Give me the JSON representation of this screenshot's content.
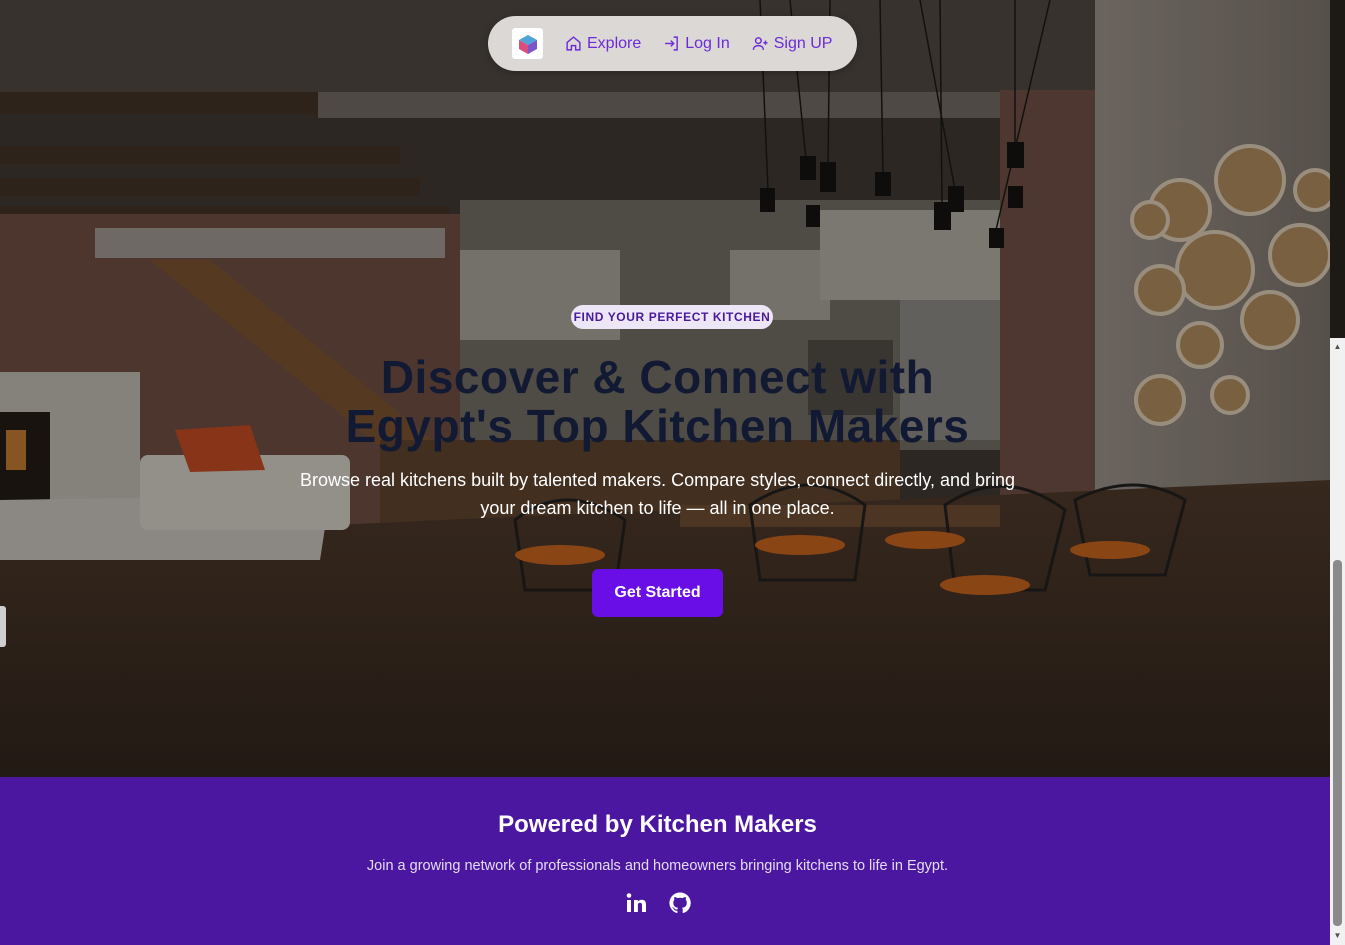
{
  "nav": {
    "logo_icon": "cube-logo-icon",
    "links": [
      {
        "label": "Explore",
        "icon": "home-icon"
      },
      {
        "label": "Log In",
        "icon": "login-icon"
      },
      {
        "label": "Sign UP",
        "icon": "user-plus-icon"
      }
    ]
  },
  "hero": {
    "badge": "FIND YOUR PERFECT KITCHEN",
    "headline": "Discover & Connect with Egypt's Top Kitchen Makers",
    "subtitle": "Browse real kitchens built by talented makers. Compare styles, connect directly, and bring your dream kitchen to life — all in one place.",
    "cta_label": "Get Started"
  },
  "footer": {
    "title": "Powered by Kitchen Makers",
    "text": "Join a growing network of professionals and homeowners bringing kitchens to life in Egypt.",
    "social": [
      "linkedin-icon",
      "github-icon"
    ]
  },
  "colors": {
    "accent": "#6a0ee8",
    "nav_link": "#6b2bd9",
    "footer_bg": "#4b16a0",
    "headline": "#121a33"
  }
}
